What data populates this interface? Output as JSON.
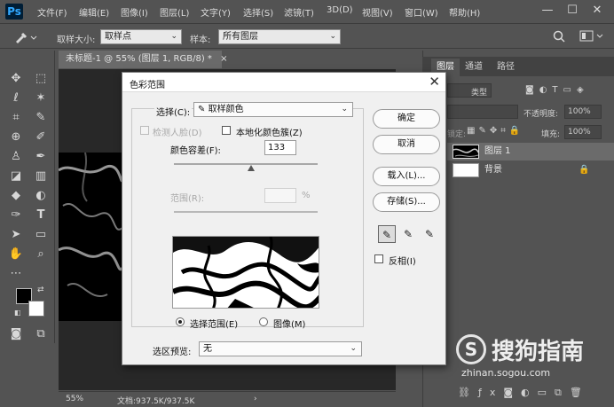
{
  "menubar": {
    "logo": "Ps",
    "items": [
      "文件(F)",
      "编辑(E)",
      "图像(I)",
      "图层(L)",
      "文字(Y)",
      "选择(S)",
      "滤镜(T)",
      "3D(D)",
      "视图(V)",
      "窗口(W)",
      "帮助(H)"
    ],
    "minimize": "—",
    "maximize": "☐",
    "close": "✕"
  },
  "options": {
    "sample_size_label": "取样大小:",
    "sample_size_value": "取样点",
    "sample_label": "样本:",
    "sample_value": "所有图层"
  },
  "document": {
    "tab_title": "未标题-1 @ 55% (图层 1, RGB/8) *",
    "tab_close": "×",
    "zoom": "55%",
    "doc_size": "文档:937.5K/937.5K"
  },
  "panels": {
    "tabs": [
      "图层",
      "通道",
      "路径"
    ],
    "kind": "类型",
    "opacity_label": "不透明度:",
    "opacity_value": "100%",
    "fill_label": "填充:",
    "fill_value": "100%",
    "lock_label": "锁定:",
    "layers": [
      {
        "name": "图层 1"
      },
      {
        "name": "背景"
      }
    ]
  },
  "dialog": {
    "title": "色彩范围",
    "close": "✕",
    "select_label": "选择(C):",
    "select_value": "取样颜色",
    "detect_faces": "检测人脸(D)",
    "localized_clusters": "本地化颜色簇(Z)",
    "fuzziness_label": "颜色容差(F):",
    "fuzziness_value": "133",
    "range_label": "范围(R):",
    "range_unit": "%",
    "ok": "确定",
    "cancel": "取消",
    "load": "载入(L)...",
    "save": "存储(S)...",
    "invert": "反相(I)",
    "radio_selection": "选择范围(E)",
    "radio_image": "图像(M)",
    "preview_label": "选区预览:",
    "preview_value": "无",
    "fuzziness_slider_fraction": 0.54
  },
  "watermark": {
    "logo": "S",
    "text": "搜狗指南",
    "url": "zhinan.sogou.com"
  }
}
